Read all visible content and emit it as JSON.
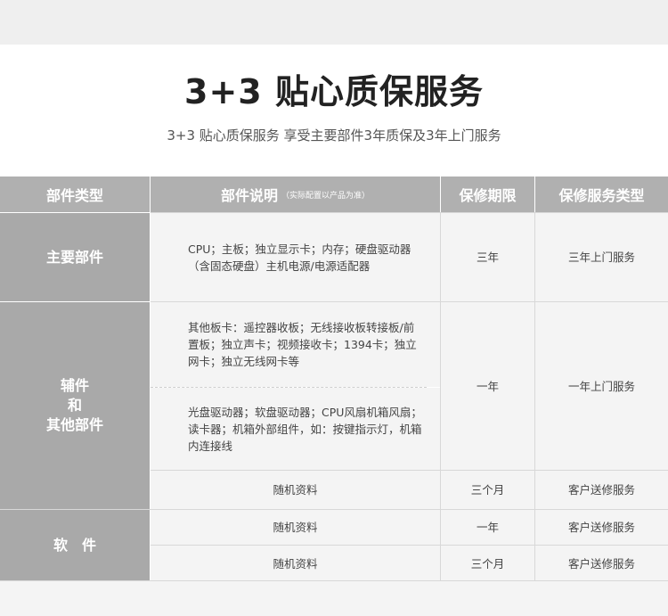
{
  "title": "3+3 贴心质保服务",
  "subtitle": "3+3 贴心质保服务 享受主要部件3年质保及3年上门服务",
  "table": {
    "headers": {
      "part_type": "部件类型",
      "part_desc": "部件说明",
      "part_desc_note": "（实际配置以产品为准）",
      "warranty_period": "保修期限",
      "service_type": "保修服务类型"
    },
    "categories": {
      "main": "主要部件",
      "accessories_line1": "辅件",
      "accessories_line2": "和",
      "accessories_line3": "其他部件",
      "software": "软　件"
    },
    "rows": [
      {
        "desc": "CPU；主板；独立显示卡；内存；硬盘驱动器（含固态硬盘）主机电源/电源适配器",
        "period": "三年",
        "service": "三年上门服务"
      },
      {
        "desc": "其他板卡：遥控器收板；无线接收板转接板/前置板；独立声卡；视频接收卡；1394卡；独立网卡；独立无线网卡等",
        "period": "一年",
        "service": "一年上门服务"
      },
      {
        "desc": "光盘驱动器；软盘驱动器；CPU风扇机箱风扇；读卡器；机箱外部组件，如：按键指示灯，机箱内连接线"
      },
      {
        "desc": "随机资料",
        "period": "三个月",
        "service": "客户送修服务"
      },
      {
        "desc": "随机资料",
        "period": "一年",
        "service": "客户送修服务"
      },
      {
        "desc": "随机资料",
        "period": "三个月",
        "service": "客户送修服务"
      }
    ]
  }
}
